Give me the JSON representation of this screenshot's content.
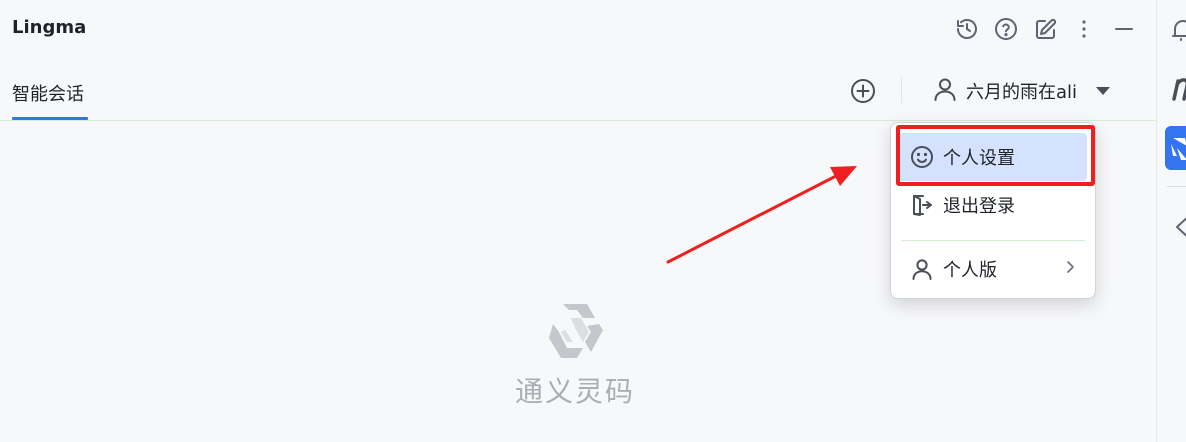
{
  "app": {
    "title": "Lingma"
  },
  "toolbar": {
    "icons": [
      "history-icon",
      "help-icon",
      "edit-icon",
      "more-vertical-icon",
      "minimize-icon"
    ]
  },
  "tabs": [
    {
      "label": "智能会话",
      "active": true
    }
  ],
  "account": {
    "name": "六月的雨在ali"
  },
  "menu": {
    "items": [
      {
        "label": "个人设置",
        "icon": "smiley-icon",
        "selected": true
      },
      {
        "label": "退出登录",
        "icon": "logout-icon",
        "selected": false
      },
      {
        "label": "个人版",
        "icon": "user-icon",
        "selected": false,
        "has_submenu": true
      }
    ]
  },
  "empty_state": {
    "text": "通义灵码"
  },
  "colors": {
    "accent": "#3574f0",
    "highlight": "#f01f1f",
    "selected_bg": "#d4e2ff",
    "muted_text": "#a9adb4"
  }
}
